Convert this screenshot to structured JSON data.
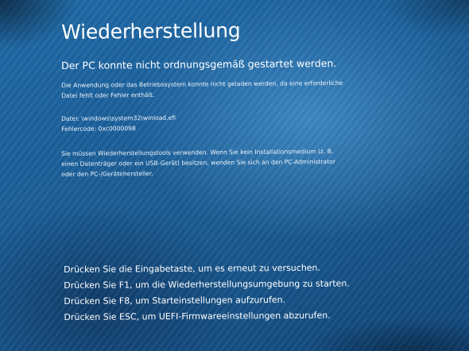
{
  "recovery": {
    "title": "Wiederherstellung",
    "subtitle": "Der PC konnte nicht ordnungsgemäß gestartet werden.",
    "description_lines": [
      "Die Anwendung oder das Betriebssystem konnte nicht geladen werden, da eine erforderliche",
      "Datei fehlt oder Fehler enthält."
    ],
    "file_line": "Datei: \\windows\\system32\\winload.efi",
    "error_code_line": "Fehlercode: 0xc0000098",
    "tools_lines": [
      "Sie müssen Wiederherstellungstools verwenden. Wenn Sie kein Installationsmedium (z. B.",
      "einen Datenträger oder ein USB-Gerät) besitzen, wenden Sie sich an den PC-Administrator",
      "oder den PC-/Gerätehersteller."
    ],
    "key_options": [
      "Drücken Sie die Eingabetaste, um es erneut zu versuchen.",
      "Drücken Sie F1, um die Wiederherstellungsumgebung zu starten.",
      "Drücken Sie F8, um Starteinstellungen aufzurufen.",
      "Drücken Sie ESC, um UEFI-Firmwareeinstellungen abzurufen."
    ]
  },
  "colors": {
    "background": "#1b5f9a",
    "text": "#ffffff"
  }
}
